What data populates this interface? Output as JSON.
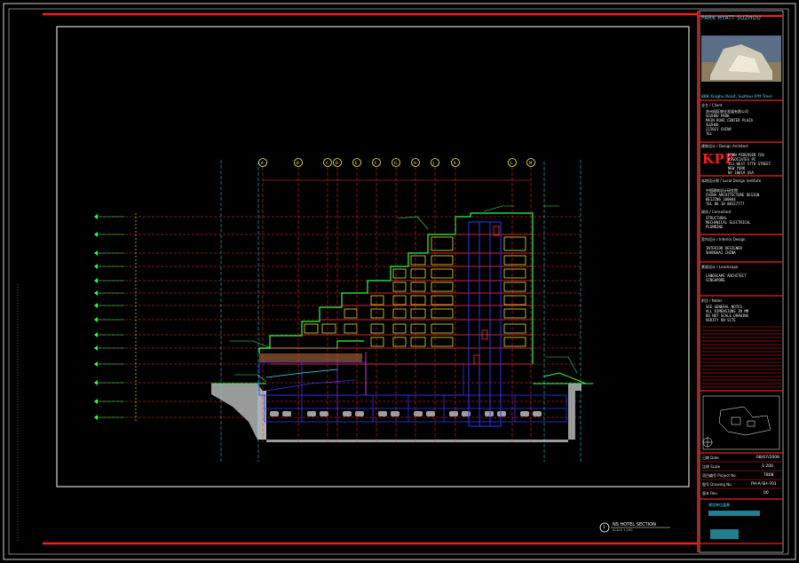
{
  "project": {
    "title": "PARK HYATT SUZHOU",
    "address": "888 Xinghu Road, Suzhou (Ptt Tree)",
    "architect_logo": "KPF"
  },
  "drawing": {
    "section_title": "NS HOTEL SECTION",
    "scale_text": "SCALE 1:200",
    "section_marker": "1",
    "grid_bubbles": [
      "A",
      "B",
      "C",
      "D",
      "E",
      "F",
      "G",
      "H",
      "J",
      "K",
      "L",
      "M"
    ],
    "level_count": 14
  },
  "titleblock": {
    "client_heading": "业主 / Client",
    "client_lines": [
      "苏州园区物业发展有限公司",
      "SUZHOU PARK",
      "MAIN ROAD CENTER PLAZA",
      "SUZHOU",
      "215021 CHINA",
      "TEL"
    ],
    "design_heading": "建筑设计 / Design Architect",
    "design_lines": [
      "KOHN PEDERSEN FOX",
      "ASSOCIATES PC",
      "111 WEST 57TH STREET",
      "NEW YORK",
      "NY 10019 USA"
    ],
    "local_heading": "本地设计院 / Local Design Institute",
    "local_lines": [
      "中国建筑设计研究院",
      "CHINA ARCHITECTURE DESIGN",
      "BEIJING 100044",
      "TEL 86 10 88327777"
    ],
    "consultant_heading": "顾问 / Consultant",
    "consultant_lines": [
      "STRUCTURAL",
      "MECHANICAL ELECTRICAL",
      "PLUMBING"
    ],
    "interior_heading": "室内设计 / Interior Design",
    "interior_lines": [
      "INTERIOR DESIGNER",
      "SHANGHAI CHINA"
    ],
    "landscape_heading": "景观设计 / Landscape",
    "landscape_lines": [
      "LANDSCAPE ARCHITECT",
      "SINGAPORE"
    ],
    "notes_heading": "附注 / Notes",
    "notes_lines": [
      "SEE GENERAL NOTES",
      "ALL DIMENSIONS IN MM",
      "DO NOT SCALE DRAWING",
      "VERIFY ON SITE"
    ],
    "date_label": "日期 Date",
    "date_value": "08/07/2008",
    "scale_label": "比例 Scale",
    "scale_value": "1:200",
    "project_no_label": "项目编号 Project No.",
    "project_no_value": "7808",
    "drawing_no_label": "图号 Drawing No.",
    "drawing_no_value": "PH-A-SH-701",
    "revision_label": "版本 Rev.",
    "revision_value": "00",
    "stamp_label": "建设单位盖章"
  },
  "colors": {
    "background": "#000000",
    "frame_red": "#ff1a1a",
    "white": "#ffffff",
    "cyan": "#39e7ff",
    "green": "#2cff4a",
    "yellow": "#ffff33",
    "blue": "#3333ff",
    "magenta": "#ff33ff",
    "gray": "#9a9a9a",
    "floor_red": "#ff2f2f"
  }
}
